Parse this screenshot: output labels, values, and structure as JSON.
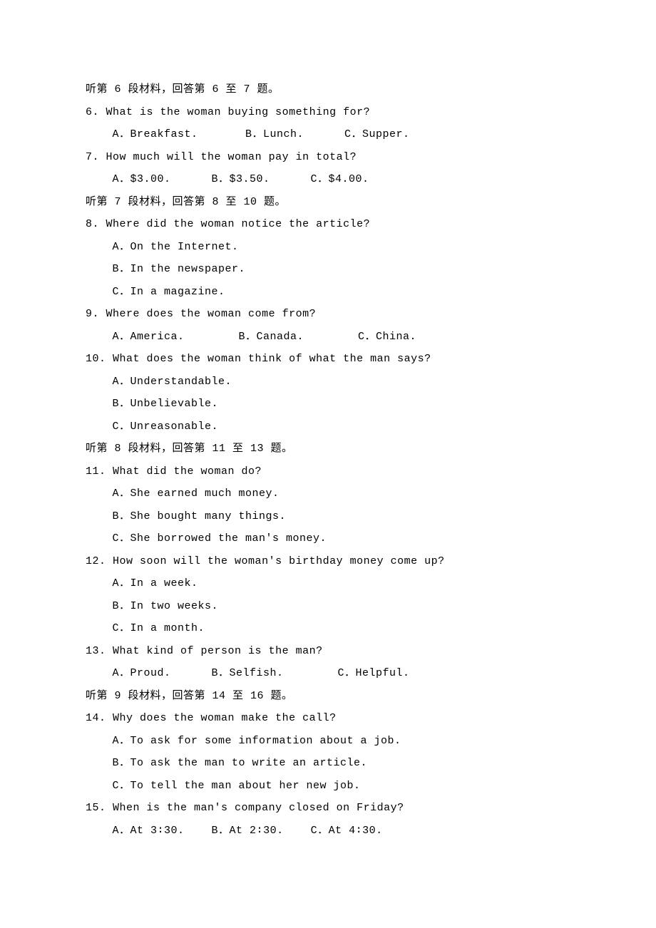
{
  "sections": [
    {
      "heading": "听第 6 段材料，回答第 6 至 7 题。",
      "questions": [
        {
          "number": "6.",
          "text": "What is the woman buying something for?",
          "options_inline": "A．Breakfast.       B．Lunch.      C．Supper."
        },
        {
          "number": "7.",
          "text": "How much will the woman pay in total?",
          "options_inline": "A．$3.00.      B．$3.50.      C．$4.00."
        }
      ]
    },
    {
      "heading": "听第 7 段材料，回答第 8 至 10 题。",
      "questions": [
        {
          "number": "8.",
          "text": "Where did the woman notice the article?",
          "options_block": [
            "A．On the Internet.",
            "B．In the newspaper.",
            "C．In a magazine."
          ]
        },
        {
          "number": "9.",
          "text": "Where does the woman come from?",
          "options_inline": "A．America.        B．Canada.        C．China."
        },
        {
          "number": "10.",
          "text": "What does the woman think of what the man says?",
          "options_block": [
            "A．Understandable.",
            "B．Unbelievable.",
            "C．Unreasonable."
          ]
        }
      ]
    },
    {
      "heading": "听第 8 段材料，回答第 11 至 13 题。",
      "questions": [
        {
          "number": "11.",
          "text": "What did the woman do?",
          "options_block": [
            "A．She earned much money.",
            "B．She bought many things.",
            "C．She borrowed the man's money."
          ]
        },
        {
          "number": "12.",
          "text": "How soon will the woman's birthday money come up?",
          "options_block": [
            "A．In a week.",
            "B．In two weeks.",
            "C．In a month."
          ]
        },
        {
          "number": "13.",
          "text": "What kind of person is the man?",
          "options_inline": "A．Proud.      B．Selfish.        C．Helpful."
        }
      ]
    },
    {
      "heading": "听第 9 段材料，回答第 14 至 16 题。",
      "questions": [
        {
          "number": "14.",
          "text": "Why does the woman make the call?",
          "options_block": [
            "A．To ask for some information about a job.",
            "B．To ask the man to write an article.",
            "C．To tell the man about her new job."
          ]
        },
        {
          "number": "15.",
          "text": "When is the man's company closed on Friday?",
          "options_inline": "A．At 3∶30.    B．At 2∶30.    C．At 4∶30."
        }
      ]
    }
  ]
}
